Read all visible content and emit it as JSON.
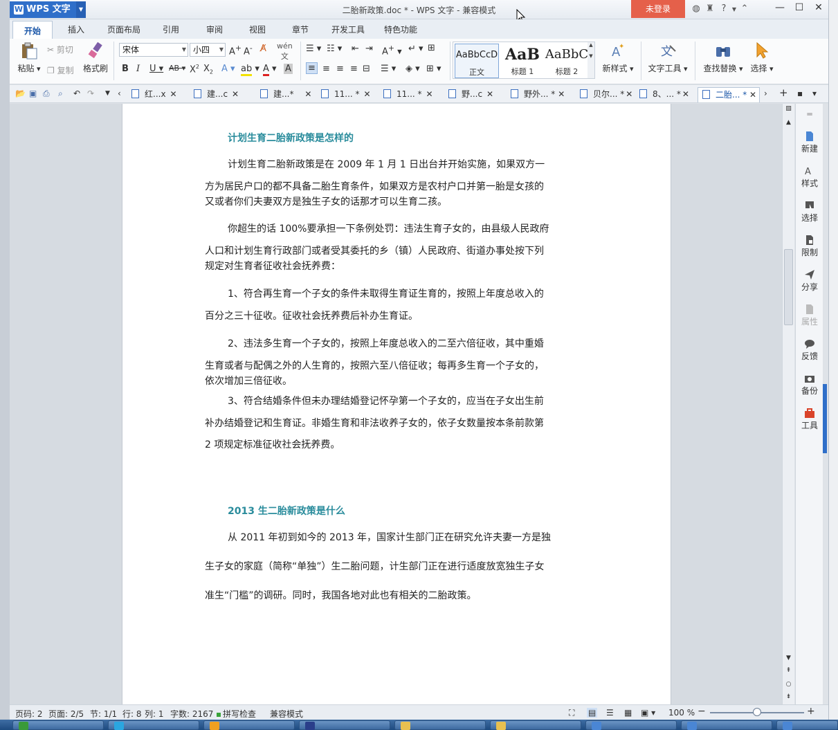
{
  "app": {
    "logo_text": "WPS 文字",
    "window_title": "二胎新政策.doc * - WPS 文字 - 兼容模式",
    "login_button": "未登录"
  },
  "menu_tabs": [
    "开始",
    "插入",
    "页面布局",
    "引用",
    "审阅",
    "视图",
    "章节",
    "开发工具",
    "特色功能"
  ],
  "ribbon": {
    "paste": "粘贴",
    "cut": "剪切",
    "copy": "复制",
    "format_painter": "格式刷",
    "font_name": "宋体",
    "font_size": "小四",
    "styles": [
      {
        "preview": "AaBbCcD",
        "name": "正文"
      },
      {
        "preview": "AaB",
        "name": "标题 1"
      },
      {
        "preview": "AaBbC",
        "name": "标题 2"
      }
    ],
    "new_style": "新样式",
    "text_tools": "文字工具",
    "find_replace": "查找替换",
    "select": "选择"
  },
  "doc_tabs": [
    "红...x",
    "建...c",
    "建...*",
    "11... *",
    "11... *",
    "野...c",
    "野外... *",
    "贝尔... *",
    "8、... *",
    "二胎... *"
  ],
  "document": {
    "heading1": "计划生育二胎新政策是怎样的",
    "p1": [
      "计划生育二胎新政策是在 2009 年 1 月 1 日出台并开始实施，如果双方一",
      "方为居民户口的都不具备二胎生育条件，如果双方是农村户口并第一胎是女孩的",
      "又或者你们夫妻双方是独生子女的话那才可以生育二孩。"
    ],
    "p2": [
      "你超生的话 100%要承担一下条例处罚：违法生育子女的，由县级人民政府",
      "人口和计划生育行政部门或者受其委托的乡（镇）人民政府、街道办事处按下列",
      "规定对生育者征收社会抚养费："
    ],
    "p3": [
      "1、符合再生育一个子女的条件未取得生育证生育的，按照上年度总收入的",
      "百分之三十征收。征收社会抚养费后补办生育证。"
    ],
    "p4": [
      "2、违法多生育一个子女的，按照上年度总收入的二至六倍征收，其中重婚",
      "生育或者与配偶之外的人生育的，按照六至八倍征收；每再多生育一个子女的，",
      "依次增加三倍征收。"
    ],
    "p5": [
      "3、符合结婚条件但未办理结婚登记怀孕第一个子女的，应当在子女出生前",
      "补办结婚登记和生育证。非婚生育和非法收养子女的，依子女数量按本条前款第",
      "2 项规定标准征收社会抚养费。"
    ],
    "heading2": "2013 生二胎新政策是什么",
    "p6": [
      "从 2011 年初到如今的 2013 年，国家计生部门正在研究允许夫妻一方是独",
      "生子女的家庭（简称“单独”）生二胎问题，计生部门正在进行适度放宽独生子女",
      "准生“门槛”的调研。同时，我国各地对此也有相关的二胎政策。"
    ]
  },
  "right_panel": [
    "新建",
    "样式",
    "选择",
    "限制",
    "分享",
    "属性",
    "反馈",
    "备份",
    "工具"
  ],
  "status": {
    "page_code": "页码: 2",
    "page": "页面: 2/5",
    "section": "节: 1/1",
    "row": "行: 8",
    "col": "列: 1",
    "word_count": "字数: 2167",
    "spell_check": "拼写检查",
    "compat": "兼容模式",
    "zoom": "100 %",
    "zoom_level": 0.5
  },
  "colors": {
    "heading": "#2a8c9c",
    "accent": "#2f6fc9",
    "login": "#e5604a"
  }
}
